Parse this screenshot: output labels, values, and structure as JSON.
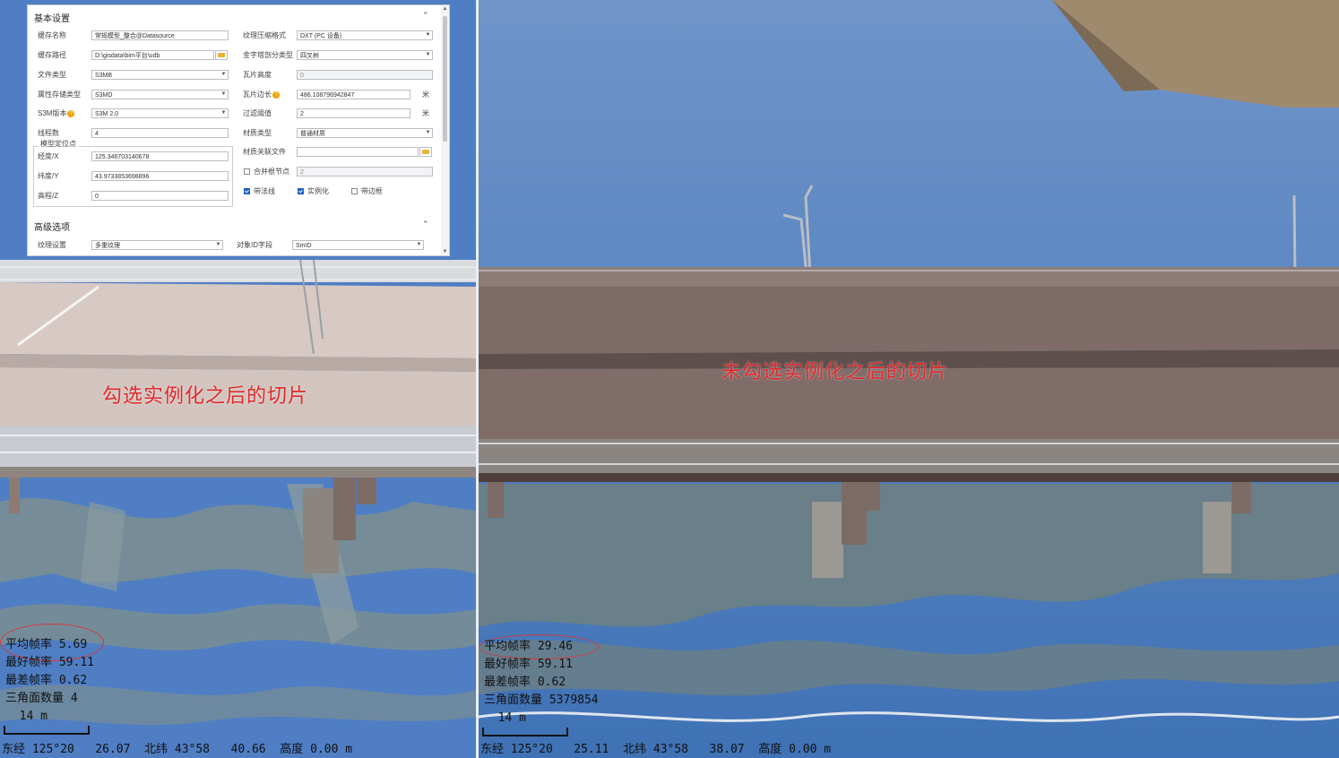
{
  "settings_panel": {
    "basic_section_title": "基本设置",
    "collapse_glyph": "⌃",
    "cache_name": {
      "label": "缓存名称",
      "value": "常规模型_整合@Datasource"
    },
    "cache_path": {
      "label": "缓存路径",
      "value": "D:\\gisdata\\bim平台\\udb"
    },
    "file_type": {
      "label": "文件类型",
      "value": "S3MB"
    },
    "attr_storage_type": {
      "label": "属性存储类型",
      "value": "S3MD"
    },
    "s3m_version": {
      "label": "S3M版本",
      "value": "S3M 2.0"
    },
    "thread_count": {
      "label": "线程数",
      "value": "4"
    },
    "model_anchor": {
      "title": "模型定位点",
      "longitude": {
        "label": "经度/X",
        "value": "125.346703140678"
      },
      "latitude": {
        "label": "纬度/Y",
        "value": "43.9733853698896"
      },
      "elevation": {
        "label": "高程/Z",
        "value": "0"
      }
    },
    "texture_compression": {
      "label": "纹理压缩格式",
      "value": "DXT (PC 设备)"
    },
    "pyramid_split": {
      "label": "金字塔剖分类型",
      "value": "四叉树"
    },
    "tile_height": {
      "label": "瓦片高度",
      "value": "0"
    },
    "tile_edge": {
      "label": "瓦片边长",
      "value": "486.108796942847",
      "unit": "米"
    },
    "filter_threshold": {
      "label": "过滤阈值",
      "value": "2",
      "unit": "米"
    },
    "material_type": {
      "label": "材质类型",
      "value": "普通材质"
    },
    "material_file": {
      "label": "材质关联文件",
      "value": ""
    },
    "merge_root": {
      "label": "合并根节点",
      "checked": false,
      "value": "2"
    },
    "checkboxes": [
      {
        "label": "带法线",
        "checked": true
      },
      {
        "label": "实例化",
        "checked": true
      },
      {
        "label": "带边框",
        "checked": false
      }
    ],
    "advanced_section_title": "高级选项",
    "texture_setting": {
      "label": "纹理设置",
      "value": "多重纹理"
    },
    "object_id_field": {
      "label": "对象ID字段",
      "value": "SmID"
    }
  },
  "left_view": {
    "caption": "勾选实例化之后的切片",
    "stats": [
      {
        "label": "平均帧率",
        "value": "5.69"
      },
      {
        "label": "最好帧率",
        "value": "59.11"
      },
      {
        "label": "最差帧率",
        "value": "0.62"
      },
      {
        "label": "三角面数量",
        "value": "4"
      }
    ],
    "scale": "14 m",
    "status": "东经 125°20   26.07  北纬 43°58   40.66  高度 0.00 m"
  },
  "right_view": {
    "caption": "未勾选实例化之后的切片",
    "stats": [
      {
        "label": "平均帧率",
        "value": "29.46"
      },
      {
        "label": "最好帧率",
        "value": "59.11"
      },
      {
        "label": "最差帧率",
        "value": "0.62"
      },
      {
        "label": "三角面数量",
        "value": "5379854"
      }
    ],
    "scale": "14 m",
    "status": "东经 125°20   25.11  北纬 43°58   38.07  高度 0.00 m"
  },
  "colors": {
    "water": "#4f7ec4",
    "reflection": "#7a8e93",
    "deck_left": "#d7c9c3",
    "deck_right": "#7f6c69",
    "caption": "#e0282a",
    "annotation_circle": "#d23a3a"
  }
}
